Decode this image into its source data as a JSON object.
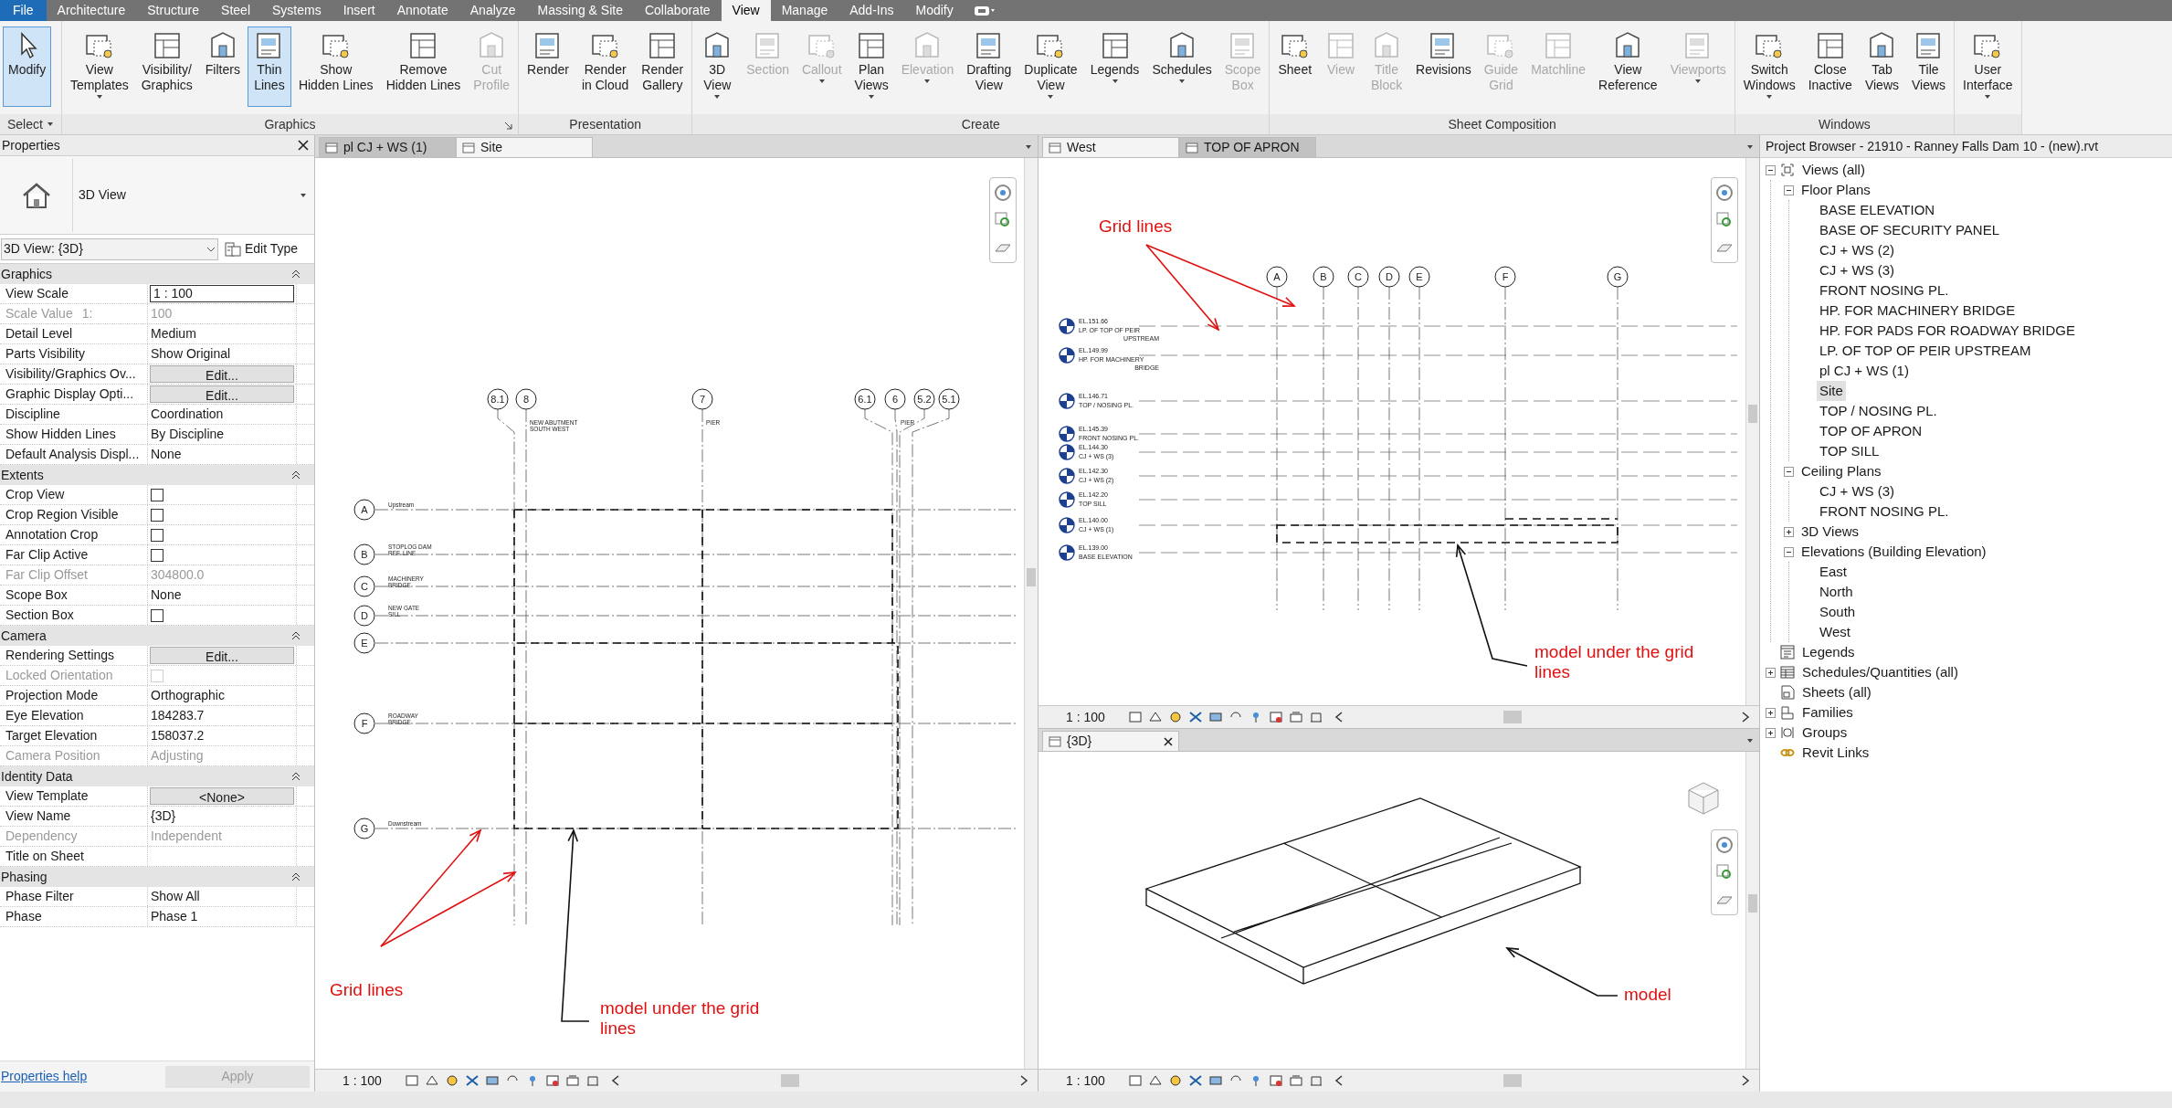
{
  "menu_tabs": [
    {
      "label": "File",
      "kind": "file",
      "selected": false
    },
    {
      "label": "Architecture",
      "kind": "tab",
      "selected": false
    },
    {
      "label": "Structure",
      "kind": "tab",
      "selected": false
    },
    {
      "label": "Steel",
      "kind": "tab",
      "selected": false
    },
    {
      "label": "Systems",
      "kind": "tab",
      "selected": false
    },
    {
      "label": "Insert",
      "kind": "tab",
      "selected": false
    },
    {
      "label": "Annotate",
      "kind": "tab",
      "selected": false
    },
    {
      "label": "Analyze",
      "kind": "tab",
      "selected": false
    },
    {
      "label": "Massing & Site",
      "kind": "tab",
      "selected": false
    },
    {
      "label": "Collaborate",
      "kind": "tab",
      "selected": false
    },
    {
      "label": "View",
      "kind": "tab",
      "selected": true
    },
    {
      "label": "Manage",
      "kind": "tab",
      "selected": false
    },
    {
      "label": "Add-Ins",
      "kind": "tab",
      "selected": false
    },
    {
      "label": "Modify",
      "kind": "tab",
      "selected": false
    }
  ],
  "ribbon_panels": [
    {
      "title": "Select",
      "menu": true,
      "launcher": false,
      "tools": [
        {
          "label": [
            "Modify"
          ],
          "selected": true,
          "disabled": false,
          "dropdown": false
        }
      ]
    },
    {
      "title": "Graphics",
      "menu": false,
      "launcher": true,
      "tools": [
        {
          "label": [
            "View",
            "Templates"
          ],
          "selected": false,
          "disabled": false,
          "dropdown": true
        },
        {
          "label": [
            "Visibility/",
            "Graphics"
          ],
          "selected": false,
          "disabled": false,
          "dropdown": false
        },
        {
          "label": [
            "Filters"
          ],
          "selected": false,
          "disabled": false,
          "dropdown": false
        },
        {
          "label": [
            "Thin",
            "Lines"
          ],
          "selected": true,
          "disabled": false,
          "dropdown": false
        },
        {
          "label": [
            "Show",
            "Hidden Lines"
          ],
          "selected": false,
          "disabled": false,
          "dropdown": false
        },
        {
          "label": [
            "Remove",
            "Hidden Lines"
          ],
          "selected": false,
          "disabled": false,
          "dropdown": false
        },
        {
          "label": [
            "Cut",
            "Profile"
          ],
          "selected": false,
          "disabled": true,
          "dropdown": false
        }
      ]
    },
    {
      "title": "Presentation",
      "menu": false,
      "launcher": false,
      "tools": [
        {
          "label": [
            "Render"
          ],
          "selected": false,
          "disabled": false,
          "dropdown": false
        },
        {
          "label": [
            "Render",
            "in Cloud"
          ],
          "selected": false,
          "disabled": false,
          "dropdown": false
        },
        {
          "label": [
            "Render",
            "Gallery"
          ],
          "selected": false,
          "disabled": false,
          "dropdown": false
        }
      ]
    },
    {
      "title": "Create",
      "menu": false,
      "launcher": false,
      "tools": [
        {
          "label": [
            "3D",
            "View"
          ],
          "selected": false,
          "disabled": false,
          "dropdown": true
        },
        {
          "label": [
            "Section"
          ],
          "selected": false,
          "disabled": true,
          "dropdown": false
        },
        {
          "label": [
            "Callout"
          ],
          "selected": false,
          "disabled": true,
          "dropdown": true
        },
        {
          "label": [
            "Plan",
            "Views"
          ],
          "selected": false,
          "disabled": false,
          "dropdown": true
        },
        {
          "label": [
            "Elevation"
          ],
          "selected": false,
          "disabled": true,
          "dropdown": true
        },
        {
          "label": [
            "Drafting",
            "View"
          ],
          "selected": false,
          "disabled": false,
          "dropdown": false
        },
        {
          "label": [
            "Duplicate",
            "View"
          ],
          "selected": false,
          "disabled": false,
          "dropdown": true
        },
        {
          "label": [
            "Legends"
          ],
          "selected": false,
          "disabled": false,
          "dropdown": true
        },
        {
          "label": [
            "Schedules"
          ],
          "selected": false,
          "disabled": false,
          "dropdown": true
        },
        {
          "label": [
            "Scope",
            "Box"
          ],
          "selected": false,
          "disabled": true,
          "dropdown": false
        }
      ]
    },
    {
      "title": "Sheet Composition",
      "menu": false,
      "launcher": false,
      "tools": [
        {
          "label": [
            "Sheet"
          ],
          "selected": false,
          "disabled": false,
          "dropdown": false
        },
        {
          "label": [
            "View"
          ],
          "selected": false,
          "disabled": true,
          "dropdown": false
        },
        {
          "label": [
            "Title",
            "Block"
          ],
          "selected": false,
          "disabled": true,
          "dropdown": false
        },
        {
          "label": [
            "Revisions"
          ],
          "selected": false,
          "disabled": false,
          "dropdown": false
        },
        {
          "label": [
            "Guide",
            "Grid"
          ],
          "selected": false,
          "disabled": true,
          "dropdown": false
        },
        {
          "label": [
            "Matchline"
          ],
          "selected": false,
          "disabled": true,
          "dropdown": false
        },
        {
          "label": [
            "View",
            "Reference"
          ],
          "selected": false,
          "disabled": false,
          "dropdown": false
        },
        {
          "label": [
            "Viewports"
          ],
          "selected": false,
          "disabled": true,
          "dropdown": true
        }
      ]
    },
    {
      "title": "Windows",
      "menu": false,
      "launcher": false,
      "tools": [
        {
          "label": [
            "Switch",
            "Windows"
          ],
          "selected": false,
          "disabled": false,
          "dropdown": true
        },
        {
          "label": [
            "Close",
            "Inactive"
          ],
          "selected": false,
          "disabled": false,
          "dropdown": false
        },
        {
          "label": [
            "Tab",
            "Views"
          ],
          "selected": false,
          "disabled": false,
          "dropdown": false
        },
        {
          "label": [
            "Tile",
            "Views"
          ],
          "selected": false,
          "disabled": false,
          "dropdown": false
        }
      ]
    },
    {
      "menu": false,
      "launcher": false,
      "tools": [
        {
          "label": [
            "User",
            "Interface"
          ],
          "selected": false,
          "disabled": false,
          "dropdown": true
        }
      ]
    }
  ],
  "properties": {
    "title": "Properties",
    "type_name": "3D View",
    "instance": "3D View: {3D}",
    "edit_type": "Edit Type",
    "sections": [
      {
        "title": "Graphics",
        "expanded": true,
        "rows": [
          {
            "name": "View Scale",
            "value": "1 : 100",
            "kind": "field",
            "disabled": false
          },
          {
            "name": "Scale Value",
            "suffix": "1:",
            "value": "100",
            "kind": "text",
            "disabled": true
          },
          {
            "name": "Detail Level",
            "value": "Medium",
            "kind": "text",
            "disabled": false
          },
          {
            "name": "Parts Visibility",
            "value": "Show Original",
            "kind": "text",
            "disabled": false
          },
          {
            "name": "Visibility/Graphics Ov...",
            "value": "Edit...",
            "kind": "button",
            "disabled": false
          },
          {
            "name": "Graphic Display Opti...",
            "value": "Edit...",
            "kind": "button",
            "disabled": false
          },
          {
            "name": "Discipline",
            "value": "Coordination",
            "kind": "text",
            "disabled": false
          },
          {
            "name": "Show Hidden Lines",
            "value": "By Discipline",
            "kind": "text",
            "disabled": false
          },
          {
            "name": "Default Analysis Displ...",
            "value": "None",
            "kind": "text",
            "disabled": false
          }
        ]
      },
      {
        "title": "Extents",
        "expanded": true,
        "rows": [
          {
            "name": "Crop View",
            "kind": "checkbox",
            "checked": false,
            "disabled": false
          },
          {
            "name": "Crop Region Visible",
            "kind": "checkbox",
            "checked": false,
            "disabled": false
          },
          {
            "name": "Annotation Crop",
            "kind": "checkbox",
            "checked": false,
            "disabled": false
          },
          {
            "name": "Far Clip Active",
            "kind": "checkbox",
            "checked": false,
            "disabled": false
          },
          {
            "name": "Far Clip Offset",
            "value": "304800.0",
            "kind": "text",
            "disabled": true
          },
          {
            "name": "Scope Box",
            "value": "None",
            "kind": "text",
            "disabled": false
          },
          {
            "name": "Section Box",
            "kind": "checkbox",
            "checked": false,
            "disabled": false
          }
        ]
      },
      {
        "title": "Camera",
        "expanded": true,
        "rows": [
          {
            "name": "Rendering Settings",
            "value": "Edit...",
            "kind": "button",
            "disabled": false
          },
          {
            "name": "Locked Orientation",
            "kind": "checkbox",
            "checked": false,
            "disabled": true
          },
          {
            "name": "Projection Mode",
            "value": "Orthographic",
            "kind": "text",
            "disabled": false
          },
          {
            "name": "Eye Elevation",
            "value": "184283.7",
            "kind": "text",
            "disabled": false
          },
          {
            "name": "Target Elevation",
            "value": "158037.2",
            "kind": "text",
            "disabled": false
          },
          {
            "name": "Camera Position",
            "value": "Adjusting",
            "kind": "text",
            "disabled": true
          }
        ]
      },
      {
        "title": "Identity Data",
        "expanded": true,
        "rows": [
          {
            "name": "View Template",
            "value": "<None>",
            "kind": "button",
            "disabled": false
          },
          {
            "name": "View Name",
            "value": "{3D}",
            "kind": "text",
            "disabled": false
          },
          {
            "name": "Dependency",
            "value": "Independent",
            "kind": "text",
            "disabled": true
          },
          {
            "name": "Title on Sheet",
            "kind": "text",
            "disabled": false
          }
        ]
      },
      {
        "title": "Phasing",
        "expanded": true,
        "rows": [
          {
            "name": "Phase Filter",
            "value": "Show All",
            "kind": "text",
            "disabled": false
          },
          {
            "name": "Phase",
            "value": "Phase 1",
            "kind": "text",
            "disabled": false
          }
        ]
      }
    ],
    "help": "Properties help",
    "apply": "Apply",
    "apply_disabled": true
  },
  "plan_view": {
    "tabs": [
      {
        "label": "pl CJ + WS (1)",
        "selected": false,
        "closable": false
      },
      {
        "label": "Site",
        "selected": true,
        "closable": false
      }
    ],
    "vertical_grids": [
      {
        "bubble": "8.1"
      },
      {
        "bubble": "8",
        "note": [
          "NEW ABUTMENT",
          "SOUTH WEST"
        ]
      },
      {
        "bubble": "7",
        "note": [
          "PIER"
        ]
      },
      {
        "bubble": "6.1"
      },
      {
        "bubble": "6",
        "note": [
          "PIER"
        ]
      },
      {
        "bubble": "5.2"
      },
      {
        "bubble": "5.1"
      }
    ],
    "horizontal_grids": [
      {
        "bubble": "A",
        "note": [
          "Upstream"
        ]
      },
      {
        "bubble": "B",
        "note": [
          "STOPLOG DAM",
          "REF. LINE"
        ]
      },
      {
        "bubble": "C",
        "note": [
          "MACHINERY",
          "BRIDGE"
        ]
      },
      {
        "bubble": "D",
        "note": [
          "NEW GATE",
          "SILL"
        ]
      },
      {
        "bubble": "E"
      },
      {
        "bubble": "F",
        "note": [
          "ROADWAY",
          "BRIDGE"
        ]
      },
      {
        "bubble": "G",
        "note": [
          "Downstream"
        ]
      }
    ],
    "annotations": [
      {
        "kind": "grid",
        "text": "Grid lines"
      },
      {
        "kind": "model",
        "text": "model under the grid lines"
      }
    ],
    "scale": "1 : 100"
  },
  "elevation_view": {
    "tabs": [
      {
        "label": "West",
        "selected": true,
        "closable": false
      },
      {
        "label": "TOP OF APRON",
        "selected": false,
        "closable": false
      }
    ],
    "grids": [
      {
        "bubble": "A"
      },
      {
        "bubble": "B"
      },
      {
        "bubble": "C"
      },
      {
        "bubble": "D"
      },
      {
        "bubble": "E"
      },
      {
        "bubble": "F"
      },
      {
        "bubble": "G"
      }
    ],
    "levels": [
      {
        "elevation": "EL.151.66",
        "name": [
          "LP. OF TOP OF PEIR",
          "UPSTREAM"
        ]
      },
      {
        "elevation": "EL.149.99",
        "name": [
          "HP. FOR MACHINERY",
          "BRIDGE"
        ]
      },
      {
        "elevation": "EL.146.71",
        "name": [
          "TOP / NOSING PL."
        ]
      },
      {
        "elevation": "EL.145.39",
        "name": [
          "FRONT NOSING PL."
        ]
      },
      {
        "elevation": "EL.144.30",
        "name": [
          "CJ + WS (3)"
        ]
      },
      {
        "elevation": "EL.142.30",
        "name": [
          "CJ + WS (2)"
        ]
      },
      {
        "elevation": "EL.142.20",
        "name": [
          "TOP SILL"
        ]
      },
      {
        "elevation": "EL.140.00",
        "name": [
          "CJ + WS (1)"
        ]
      },
      {
        "elevation": "EL.139.00",
        "name": [
          "BASE ELEVATION"
        ]
      }
    ],
    "annotations": [
      {
        "kind": "grid",
        "text": "Grid lines"
      },
      {
        "kind": "model",
        "text": "model under the grid lines"
      }
    ],
    "scale": "1 : 100"
  },
  "view_3d": {
    "tabs": [
      {
        "label": "{3D}",
        "selected": true,
        "closable": true
      }
    ],
    "annotations": [
      {
        "kind": "model",
        "text": "model"
      }
    ],
    "scale": "1 : 100"
  },
  "project_browser": {
    "title": "Project Browser - 21910 - Ranney Falls Dam 10 - (new).rvt",
    "items": [
      {
        "label": "Views (all)",
        "kind": "views",
        "expanded": true,
        "selected": false,
        "children": [
          {
            "label": "Floor Plans",
            "expanded": true,
            "selected": false,
            "children": [
              {
                "label": "BASE ELEVATION",
                "selected": false
              },
              {
                "label": "BASE OF SECURITY PANEL",
                "selected": false
              },
              {
                "label": "CJ + WS (2)",
                "selected": false
              },
              {
                "label": "CJ + WS (3)",
                "selected": false
              },
              {
                "label": "FRONT NOSING PL.",
                "selected": false
              },
              {
                "label": "HP. FOR MACHINERY BRIDGE",
                "selected": false
              },
              {
                "label": "HP. FOR PADS FOR ROADWAY BRIDGE",
                "selected": false
              },
              {
                "label": "LP. OF TOP OF PEIR UPSTREAM",
                "selected": false
              },
              {
                "label": "pl CJ + WS (1)",
                "selected": false
              },
              {
                "label": "Site",
                "selected": true
              },
              {
                "label": "TOP / NOSING PL.",
                "selected": false
              },
              {
                "label": "TOP OF APRON",
                "selected": false
              },
              {
                "label": "TOP SILL",
                "selected": false
              }
            ]
          },
          {
            "label": "Ceiling Plans",
            "expanded": true,
            "selected": false,
            "children": [
              {
                "label": "CJ + WS (3)",
                "selected": false
              },
              {
                "label": "FRONT NOSING PL.",
                "selected": false
              }
            ]
          },
          {
            "label": "3D Views",
            "expanded": false,
            "selected": false
          },
          {
            "label": "Elevations (Building Elevation)",
            "expanded": true,
            "selected": false,
            "children": [
              {
                "label": "East",
                "selected": false
              },
              {
                "label": "North",
                "selected": false
              },
              {
                "label": "South",
                "selected": false
              },
              {
                "label": "West",
                "selected": false
              }
            ]
          }
        ]
      },
      {
        "label": "Legends",
        "kind": "legends",
        "selected": false
      },
      {
        "label": "Schedules/Quantities (all)",
        "kind": "schedules",
        "expanded": false,
        "selected": false
      },
      {
        "label": "Sheets (all)",
        "kind": "sheets",
        "selected": false
      },
      {
        "label": "Families",
        "kind": "families",
        "expanded": false,
        "selected": false
      },
      {
        "label": "Groups",
        "kind": "groups",
        "expanded": false,
        "selected": false
      },
      {
        "label": "Revit Links",
        "kind": "links",
        "selected": false
      }
    ]
  }
}
